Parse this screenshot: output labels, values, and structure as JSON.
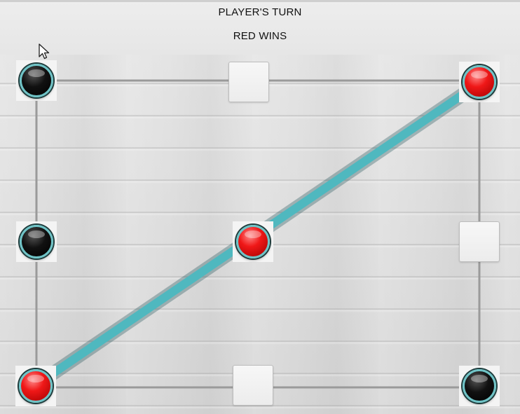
{
  "header": {
    "turn_label": "PLAYER'S TURN",
    "status_label": "RED WINS"
  },
  "board": {
    "rows": 3,
    "cols": 3,
    "cells": [
      {
        "id": "top-left",
        "state": "black"
      },
      {
        "id": "top-middle",
        "state": "empty"
      },
      {
        "id": "top-right",
        "state": "red"
      },
      {
        "id": "middle-left",
        "state": "black"
      },
      {
        "id": "center",
        "state": "red"
      },
      {
        "id": "middle-right",
        "state": "empty"
      },
      {
        "id": "bottom-left",
        "state": "red"
      },
      {
        "id": "bottom-middle",
        "state": "empty"
      },
      {
        "id": "bottom-right",
        "state": "black"
      }
    ],
    "winner": "red",
    "winning_line": [
      "bottom-left",
      "center",
      "top-right"
    ]
  },
  "colors": {
    "red_piece": "#f01818",
    "black_piece": "#000000",
    "piece_ring": "#6fc3c6",
    "win_line": "#4fb8bf",
    "grid_line": "#9a9a9a"
  }
}
